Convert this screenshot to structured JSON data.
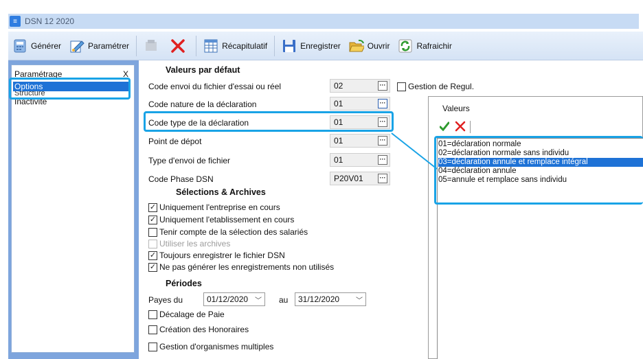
{
  "window": {
    "title": "DSN 12 2020"
  },
  "toolbar": {
    "generer": "Générer",
    "parametrer": "Paramétrer",
    "recapitulatif": "Récapitulatif",
    "enregistrer": "Enregistrer",
    "ouvrir": "Ouvrir",
    "rafraichir": "Rafraichir"
  },
  "sidebar": {
    "close": "X",
    "items": [
      {
        "label": "Paramétrage"
      },
      {
        "label": "Options"
      },
      {
        "label": "Structure"
      },
      {
        "label": "Inactivité"
      }
    ]
  },
  "form": {
    "defaults_header": "Valeurs par défaut",
    "fields": [
      {
        "label": "Code envoi du fichier d'essai ou réel",
        "value": "02"
      },
      {
        "label": "Code nature de la déclaration",
        "value": "01"
      },
      {
        "label": "Code type de la déclaration",
        "value": "01"
      },
      {
        "label": "Point de dépot",
        "value": "01"
      },
      {
        "label": "Type d'envoi de fichier",
        "value": "01"
      },
      {
        "label": "Code Phase DSN",
        "value": "P20V01"
      }
    ],
    "gestion_regul": "Gestion de Regul.",
    "selections_header": "Sélections & Archives",
    "checks": [
      {
        "label": "Uniquement l'entreprise en cours",
        "checked": "✓"
      },
      {
        "label": "Uniquement l'etablissement en cours",
        "checked": "✓"
      },
      {
        "label": "Tenir compte de la sélection des salariés",
        "checked": ""
      },
      {
        "label": "Utiliser les archives",
        "checked": ""
      },
      {
        "label": "Toujours enregistrer le fichier DSN",
        "checked": "✓"
      },
      {
        "label": "Ne pas générer les enregistrements non utilisés",
        "checked": "✓"
      }
    ],
    "periodes_header": "Périodes",
    "payes_du": "Payes du",
    "date_from": "01/12/2020",
    "au": "au",
    "date_to": "31/12/2020",
    "decalage": "Décalage de Paie",
    "honoraires": "Création des Honoraires",
    "organismes": "Gestion d'organismes multiples"
  },
  "popup": {
    "title": "Valeurs",
    "items": [
      "01=déclaration normale",
      "02=déclaration normale sans individu",
      "03=déclaration annule et remplace intégral",
      "04=déclaration annule",
      "05=annule et remplace sans individu"
    ]
  },
  "colors": {
    "highlight": "#19a3e6",
    "selection": "#1e72d6",
    "panel": "#7ea5dd"
  }
}
